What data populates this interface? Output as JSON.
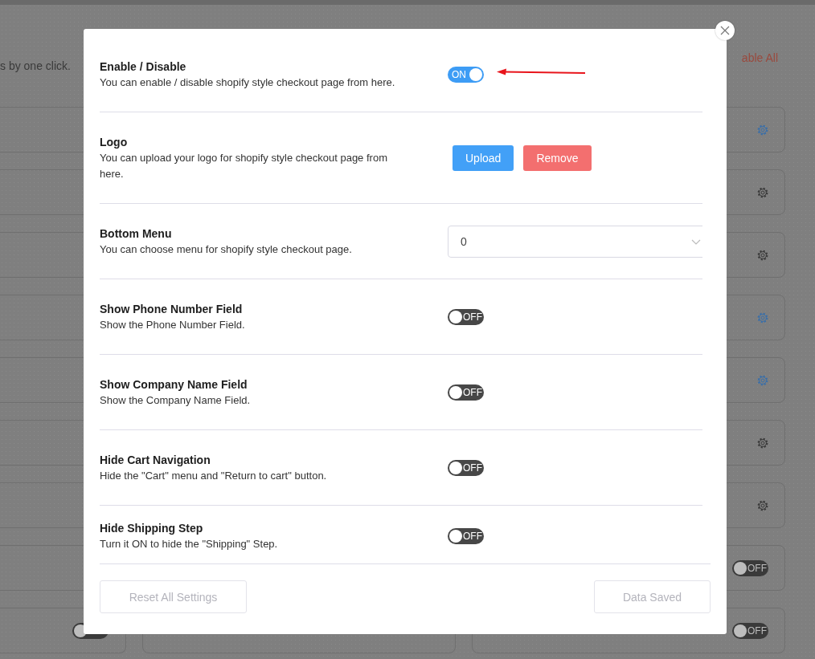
{
  "background": {
    "intro_text": "s by one click.",
    "bulk_action": "able All",
    "cards": [
      {
        "kind": "gear",
        "highlighted": true
      },
      {
        "kind": "gear",
        "highlighted": false
      },
      {
        "kind": "gear",
        "highlighted": false
      },
      {
        "kind": "gear",
        "highlighted": true
      },
      {
        "kind": "gear",
        "highlighted": true
      },
      {
        "kind": "gear",
        "highlighted": false
      },
      {
        "kind": "gear",
        "highlighted": false
      },
      {
        "kind": "toggle",
        "on": false,
        "label": "OFF"
      },
      {
        "kind": "toggle",
        "on": false,
        "label": "OFF"
      }
    ]
  },
  "modal": {
    "settings": [
      {
        "kind": "toggle",
        "title": "Enable / Disable",
        "description": "You can enable / disable shopify style checkout page from here.",
        "on": true,
        "label": "ON"
      },
      {
        "kind": "buttons",
        "title": "Logo",
        "description": "You can upload your logo for shopify style checkout page from here.",
        "buttons": [
          "Upload",
          "Remove"
        ]
      },
      {
        "kind": "select",
        "title": "Bottom Menu",
        "description": "You can choose menu for shopify style checkout page.",
        "value": "0"
      },
      {
        "kind": "toggle",
        "title": "Show Phone Number Field",
        "description": "Show the Phone Number Field.",
        "on": false,
        "label": "OFF"
      },
      {
        "kind": "toggle",
        "title": "Show Company Name Field",
        "description": "Show the Company Name Field.",
        "on": false,
        "label": "OFF"
      },
      {
        "kind": "toggle",
        "title": "Hide Cart Navigation",
        "description": "Hide the \"Cart\" menu and \"Return to cart\" button.",
        "on": false,
        "label": "OFF"
      },
      {
        "kind": "toggle",
        "title": "Hide Shipping Step",
        "description": "Turn it ON to hide the \"Shipping\" Step.",
        "on": false,
        "label": "OFF"
      }
    ],
    "footer_buttons": [
      "Reset All Settings",
      "Data Saved"
    ]
  }
}
